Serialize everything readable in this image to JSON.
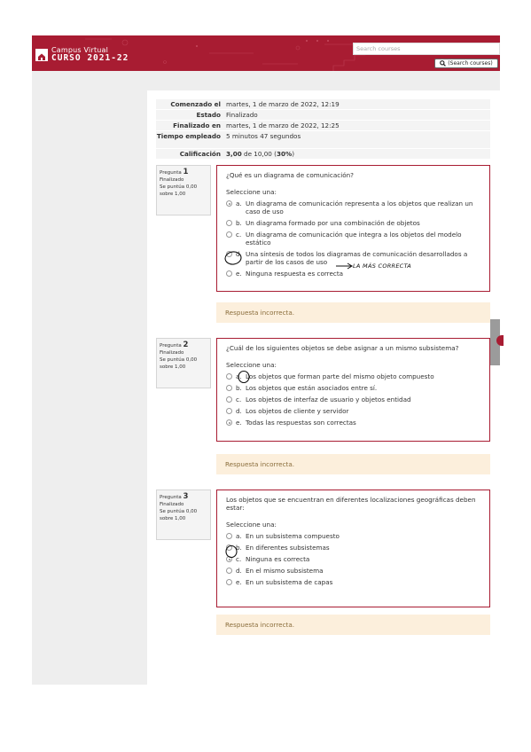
{
  "header": {
    "brand_line1": "Campus Virtual",
    "brand_line2": "CURSO 2021-22",
    "search_placeholder": "Search courses",
    "search_button": "(Search courses)",
    "search_icon": "magnifier-icon",
    "home_icon": "home-icon",
    "accent_color": "#a81c32"
  },
  "summary": [
    {
      "label": "Comenzado el",
      "value": "martes, 1 de marzo de 2022, 12:19"
    },
    {
      "label": "Estado",
      "value": "Finalizado"
    },
    {
      "label": "Finalizado en",
      "value": "martes, 1 de marzo de 2022, 12:25"
    },
    {
      "label": "Tiempo empleado",
      "value": "5 minutos 47 segundos"
    },
    {
      "label": "Calificación",
      "value_bold": "3,00",
      "value_rest": " de 10,00 (",
      "value_pct": "30%",
      "value_end": ")"
    }
  ],
  "questions": [
    {
      "label": "Pregunta",
      "number": "1",
      "state": "Finalizado",
      "score": "Se puntúa 0,00 sobre 1,00",
      "text": "¿Qué es un diagrama de comunicación?",
      "prompt": "Seleccione una:",
      "options": [
        {
          "letter": "a.",
          "text": "Un diagrama de comunicación  representa a los objetos que realizan un caso de uso"
        },
        {
          "letter": "b.",
          "text": "Un diagrama formado por una combinación de objetos"
        },
        {
          "letter": "c.",
          "text": "Un diagrama de comunicación que integra a los objetos del modelo estático"
        },
        {
          "letter": "d.",
          "text": "Una síntesis de todos los diagramas de comunicación desarrollados a partir de los casos de uso"
        },
        {
          "letter": "e.",
          "text": "Ninguna respuesta es correcta"
        }
      ],
      "selected": 0,
      "feedback": "Respuesta incorrecta.",
      "handwritten": "LA MÁS CORRECTA"
    },
    {
      "label": "Pregunta",
      "number": "2",
      "state": "Finalizado",
      "score": "Se puntúa 0,00 sobre 1,00",
      "text": "¿Cuál de los siguientes objetos se debe asignar a un mismo subsistema?",
      "prompt": "Seleccione una:",
      "options": [
        {
          "letter": "a.",
          "text": "Los objetos que forman parte del mismo objeto compuesto"
        },
        {
          "letter": "b.",
          "text": "Los objetos que están asociados entre sí."
        },
        {
          "letter": "c.",
          "text": "Los objetos de interfaz de usuario y objetos entidad"
        },
        {
          "letter": "d.",
          "text": "Los objetos de cliente y servidor"
        },
        {
          "letter": "e.",
          "text": "Todas las respuestas son correctas"
        }
      ],
      "selected": 4,
      "feedback": "Respuesta incorrecta."
    },
    {
      "label": "Pregunta",
      "number": "3",
      "state": "Finalizado",
      "score": "Se puntúa 0,00 sobre 1,00",
      "text": "Los objetos que se encuentran en diferentes localizaciones  geográficas deben estar:",
      "prompt": "Seleccione una:",
      "options": [
        {
          "letter": "a.",
          "text": "En un subsistema compuesto"
        },
        {
          "letter": "b.",
          "text": "En diferentes subsistemas"
        },
        {
          "letter": "c.",
          "text": "Ninguna es correcta"
        },
        {
          "letter": "d.",
          "text": "En el mismo subsistema"
        },
        {
          "letter": "e.",
          "text": "En un subsistema de capas"
        }
      ],
      "selected": 2,
      "feedback": "Respuesta incorrecta."
    }
  ]
}
